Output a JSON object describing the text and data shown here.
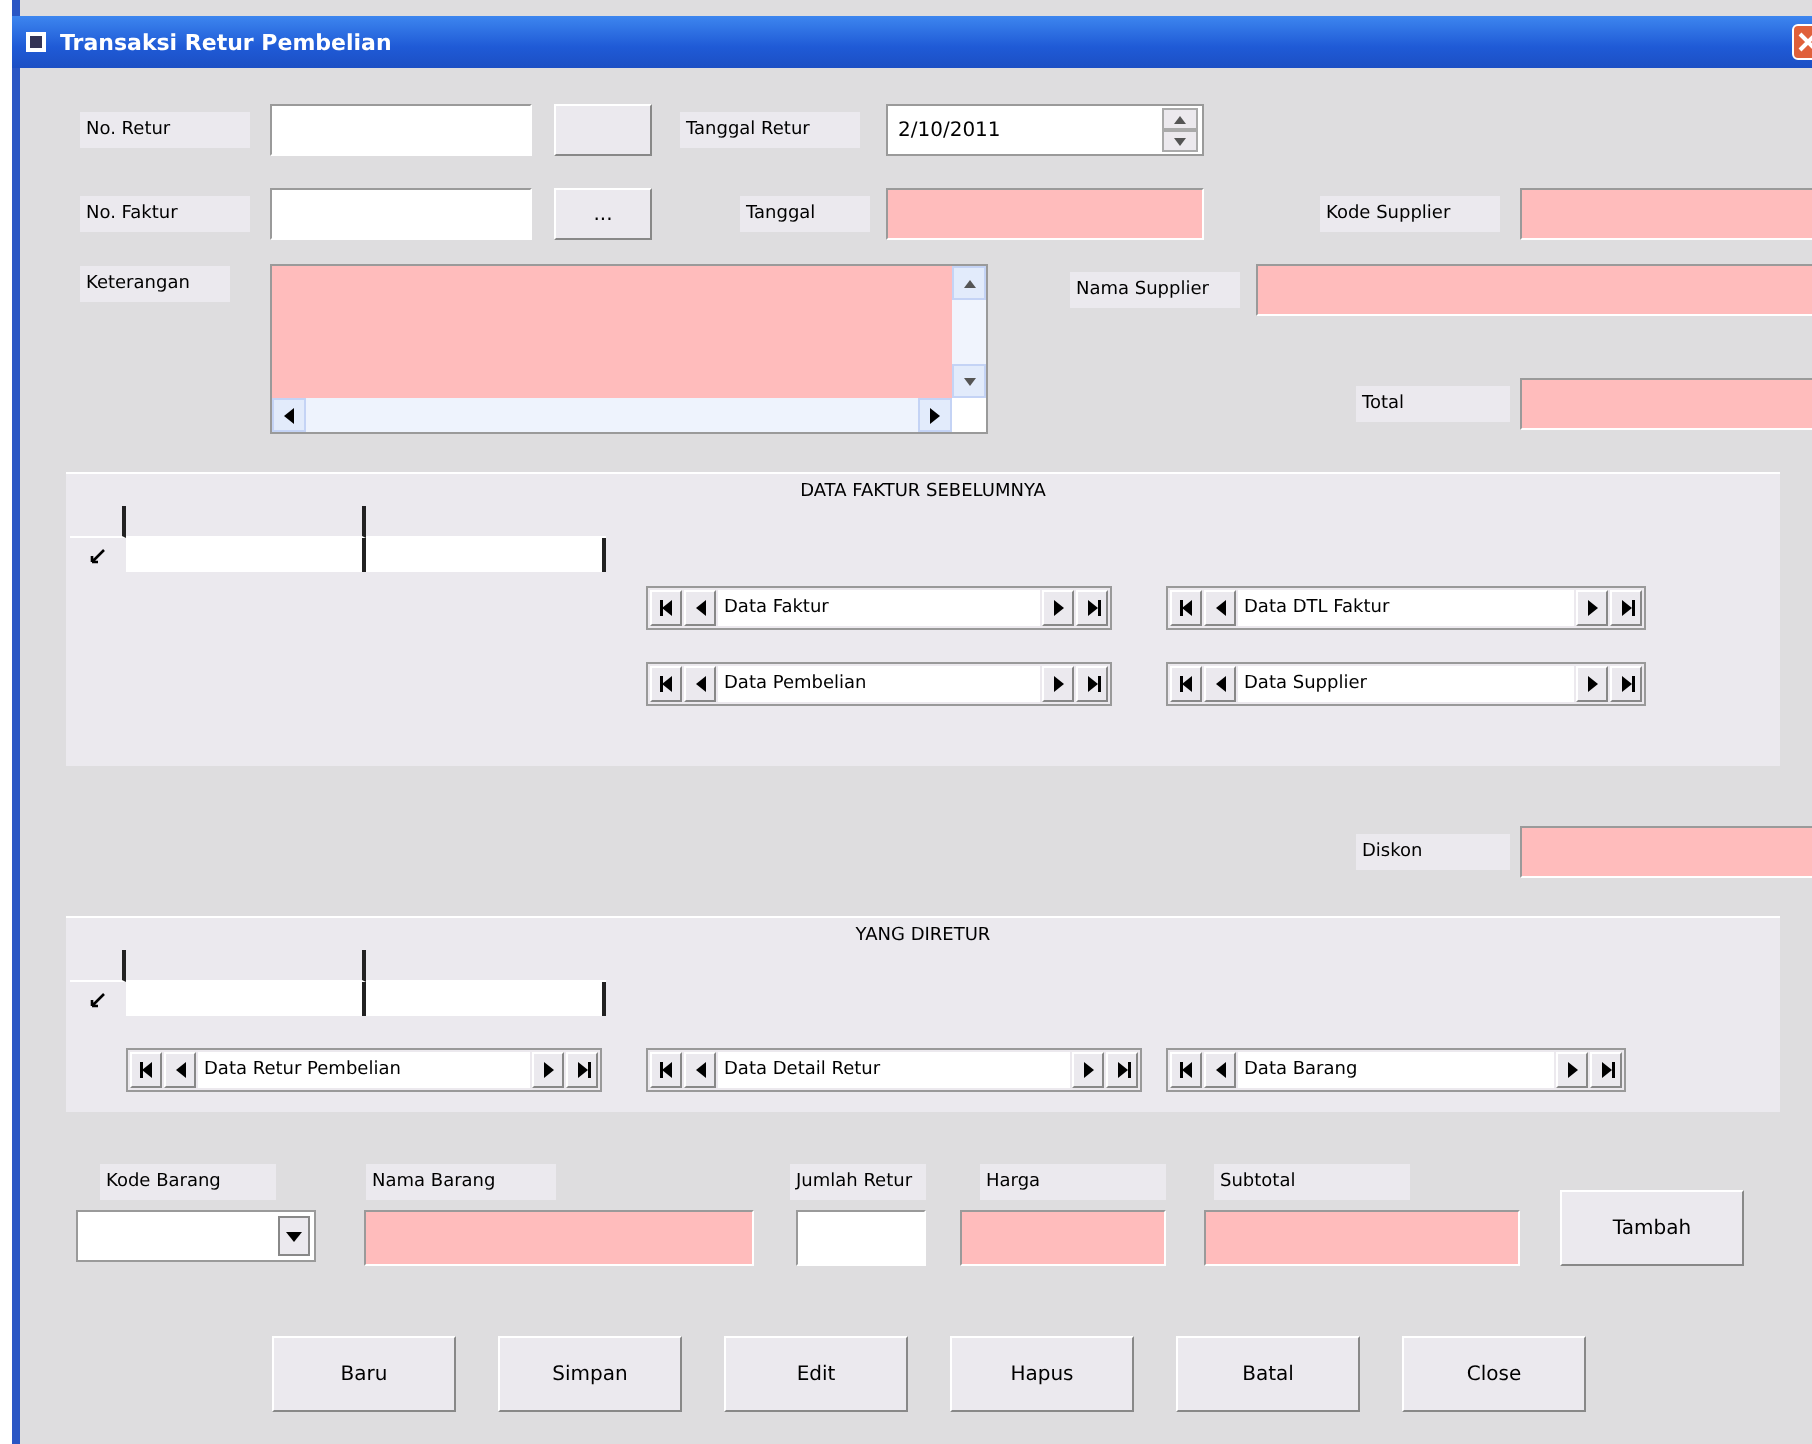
{
  "window": {
    "title": "Transaksi Retur Pembelian"
  },
  "header_fields": [
    {
      "kind": "text",
      "label": "No. Retur",
      "browse_button": true,
      "highlighted": false
    },
    {
      "kind": "date",
      "label": "Tanggal Retur",
      "value": "2/10/2011",
      "highlighted": false
    },
    {
      "kind": "text",
      "label": "No. Faktur",
      "browse_button": true,
      "browse_text": "...",
      "highlighted": false
    },
    {
      "kind": "text",
      "label": "Tanggal",
      "highlighted": true
    },
    {
      "kind": "text",
      "label": "Kode Supplier",
      "highlighted": true
    },
    {
      "kind": "memo",
      "label": "Keterangan",
      "highlighted": true
    },
    {
      "kind": "text",
      "label": "Nama Supplier",
      "highlighted": true
    },
    {
      "kind": "text",
      "label": "Total",
      "highlighted": true
    },
    {
      "kind": "text",
      "label": "Diskon",
      "highlighted": true
    }
  ],
  "panels": [
    {
      "caption": "DATA FAKTUR SEBELUMNYA",
      "navigators": [
        {
          "label": "Data Faktur"
        },
        {
          "label": "Data DTL Faktur"
        },
        {
          "label": "Data Pembelian"
        },
        {
          "label": "Data Supplier"
        }
      ]
    },
    {
      "caption": "YANG DIRETUR",
      "navigators": [
        {
          "label": "Data Retur Pembelian"
        },
        {
          "label": "Data Detail Retur"
        },
        {
          "label": "Data Barang"
        }
      ]
    }
  ],
  "item_fields": [
    {
      "kind": "combo",
      "label": "Kode Barang",
      "highlighted": false
    },
    {
      "kind": "text",
      "label": "Nama Barang",
      "highlighted": true
    },
    {
      "kind": "text",
      "label": "Jumlah Retur",
      "highlighted": false
    },
    {
      "kind": "text",
      "label": "Harga",
      "highlighted": true
    },
    {
      "kind": "text",
      "label": "Subtotal",
      "highlighted": true
    }
  ],
  "add_button": "Tambah",
  "buttons": [
    "Baru",
    "Simpan",
    "Edit",
    "Hapus",
    "Batal",
    "Close"
  ]
}
